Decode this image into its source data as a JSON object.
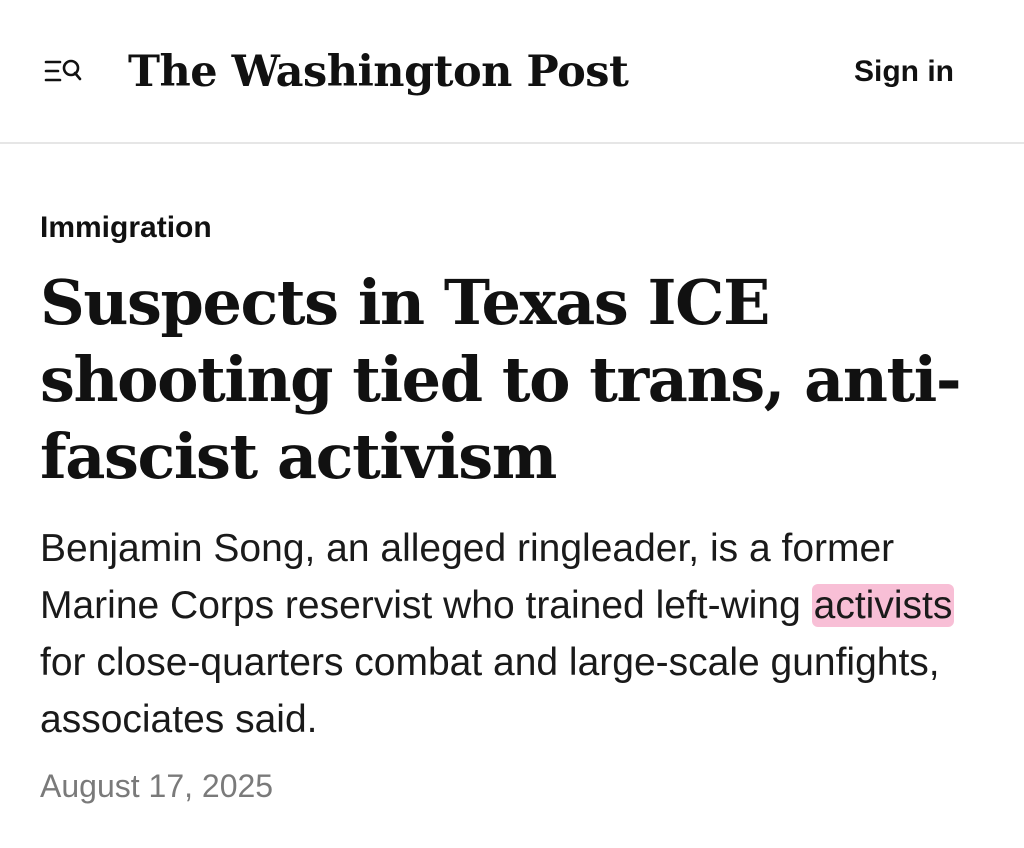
{
  "header": {
    "masthead": "The Washington Post",
    "signin_label": "Sign in",
    "menu_icon": "menu-search-icon"
  },
  "article": {
    "section": "Immigration",
    "headline": "Suspects in Texas ICE shooting tied to trans, anti-fascist activism",
    "dek_before": "Benjamin Song, an alleged ringleader, is a former Marine Corps reservist who trained left-wing ",
    "dek_highlight": "activists",
    "dek_after": " for close-quarters combat and large-scale gunfights, associates said.",
    "date": "August 17, 2025"
  },
  "colors": {
    "highlight": "#f8bfd6",
    "date_text": "#7a7a7a",
    "divider": "#e6e6e6"
  }
}
